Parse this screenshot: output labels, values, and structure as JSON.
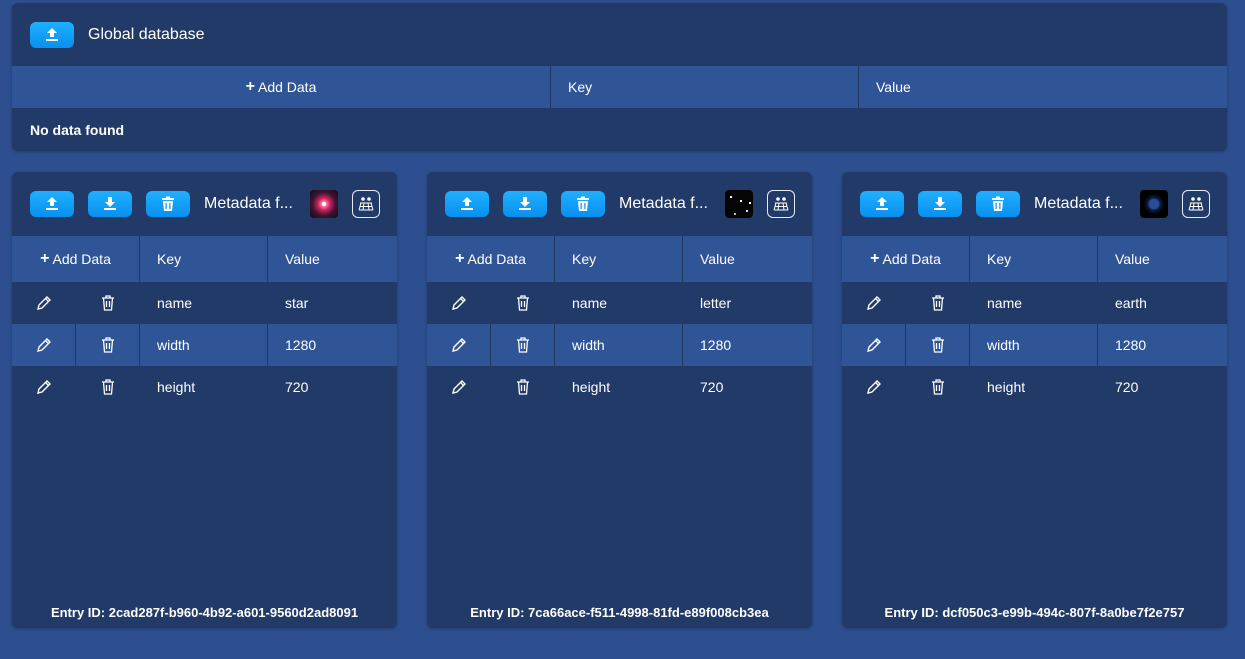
{
  "global": {
    "title": "Global database",
    "add_label": "Add Data",
    "key_header": "Key",
    "value_header": "Value",
    "empty_text": "No data found"
  },
  "cards": [
    {
      "title": "Metadata f...",
      "thumb_icon": "star-image-thumbnail",
      "add_label": "Add Data",
      "key_header": "Key",
      "value_header": "Value",
      "rows": [
        {
          "key": "name",
          "value": "star"
        },
        {
          "key": "width",
          "value": "1280"
        },
        {
          "key": "height",
          "value": "720"
        }
      ],
      "entry_id": "Entry ID: 2cad287f-b960-4b92-a601-9560d2ad8091"
    },
    {
      "title": "Metadata f...",
      "thumb_icon": "letter-image-thumbnail",
      "add_label": "Add Data",
      "key_header": "Key",
      "value_header": "Value",
      "rows": [
        {
          "key": "name",
          "value": "letter"
        },
        {
          "key": "width",
          "value": "1280"
        },
        {
          "key": "height",
          "value": "720"
        }
      ],
      "entry_id": "Entry ID: 7ca66ace-f511-4998-81fd-e89f008cb3ea"
    },
    {
      "title": "Metadata f...",
      "thumb_icon": "earth-image-thumbnail",
      "add_label": "Add Data",
      "key_header": "Key",
      "value_header": "Value",
      "rows": [
        {
          "key": "name",
          "value": "earth"
        },
        {
          "key": "width",
          "value": "1280"
        },
        {
          "key": "height",
          "value": "720"
        }
      ],
      "entry_id": "Entry ID: dcf050c3-e99b-494c-807f-8a0be7f2e757"
    }
  ],
  "colors": {
    "background": "#2d4f8f",
    "panel": "#213a68",
    "header_row": "#2f5596",
    "button": "#0a8ff0"
  }
}
